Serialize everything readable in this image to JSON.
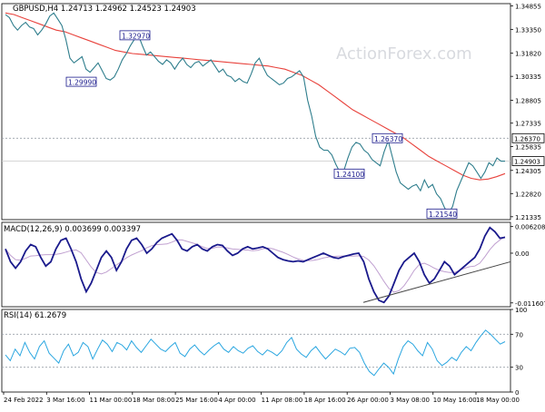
{
  "header": {
    "symbol_line": "GBPUSD,H4  1.24713 1.24962 1.24523 1.24903"
  },
  "watermark": "ActionForex.com",
  "colors": {
    "price": "#2e7d8c",
    "ma": "#e8423c",
    "macd": "#1a1a8c",
    "signal": "#c0a0d0",
    "rsi": "#2aa6e0",
    "axis": "#000000",
    "grid_dotted": "#9aa0a8",
    "label_border": "#1a1a8c"
  },
  "chart_data": [
    {
      "type": "line",
      "title": "GBPUSD,H4",
      "series": [
        {
          "name": "GBPUSD,H4",
          "values": [
            1.343,
            1.341,
            1.336,
            1.333,
            1.336,
            1.338,
            1.335,
            1.334,
            1.33,
            1.333,
            1.337,
            1.342,
            1.344,
            1.34,
            1.336,
            1.327,
            1.315,
            1.312,
            1.314,
            1.316,
            1.308,
            1.306,
            1.309,
            1.312,
            1.307,
            1.302,
            1.301,
            1.303,
            1.308,
            1.314,
            1.318,
            1.323,
            1.327,
            1.3297,
            1.323,
            1.317,
            1.319,
            1.316,
            1.313,
            1.311,
            1.314,
            1.312,
            1.308,
            1.312,
            1.315,
            1.311,
            1.309,
            1.312,
            1.313,
            1.31,
            1.312,
            1.314,
            1.31,
            1.306,
            1.308,
            1.304,
            1.303,
            1.3,
            1.302,
            1.3,
            1.299,
            1.305,
            1.312,
            1.315,
            1.309,
            1.304,
            1.302,
            1.3,
            1.298,
            1.299,
            1.302,
            1.303,
            1.305,
            1.307,
            1.303,
            1.288,
            1.278,
            1.265,
            1.258,
            1.256,
            1.256,
            1.253,
            1.247,
            1.242,
            1.243,
            1.251,
            1.258,
            1.261,
            1.26,
            1.256,
            1.254,
            1.25,
            1.248,
            1.246,
            1.255,
            1.262,
            1.252,
            1.242,
            1.235,
            1.233,
            1.231,
            1.233,
            1.234,
            1.23,
            1.237,
            1.232,
            1.234,
            1.228,
            1.225,
            1.219,
            1.2154,
            1.22,
            1.23,
            1.236,
            1.242,
            1.248,
            1.246,
            1.242,
            1.238,
            1.242,
            1.248,
            1.246,
            1.251,
            1.249,
            1.249
          ]
        },
        {
          "name": "MA",
          "values": [
            1.344,
            1.343,
            1.341,
            1.339,
            1.337,
            1.335,
            1.333,
            1.332,
            1.33,
            1.328,
            1.326,
            1.324,
            1.322,
            1.32,
            1.319,
            1.318,
            1.3175,
            1.317,
            1.3165,
            1.316,
            1.3155,
            1.315,
            1.3145,
            1.314,
            1.3135,
            1.313,
            1.3125,
            1.312,
            1.3115,
            1.311,
            1.3105,
            1.31,
            1.309,
            1.308,
            1.306,
            1.304,
            1.301,
            1.298,
            1.294,
            1.29,
            1.286,
            1.282,
            1.279,
            1.276,
            1.273,
            1.27,
            1.267,
            1.264,
            1.26,
            1.256,
            1.252,
            1.249,
            1.246,
            1.243,
            1.24,
            1.238,
            1.237,
            1.2375,
            1.239,
            1.241
          ]
        }
      ],
      "price_labels": [
        "1.32970",
        "1.29990",
        "1.26370",
        "1.24100",
        "1.21540"
      ],
      "y_ticks": [
        "1.34855",
        "1.33350",
        "1.31820",
        "1.30335",
        "1.28805",
        "1.27335",
        "1.25835",
        "1.24305",
        "1.22820",
        "1.21335"
      ],
      "marked_levels": [
        "1.26370",
        "1.24903"
      ],
      "ylim": [
        1.2115,
        1.35
      ]
    },
    {
      "type": "line",
      "title": "MACD(12,26,9) 0.003699 0.003397",
      "series": [
        {
          "name": "MACD",
          "values": [
            0.001,
            -0.002,
            -0.0035,
            -0.002,
            0.0005,
            0.002,
            0.0015,
            -0.001,
            -0.003,
            -0.002,
            0.001,
            0.003,
            0.0035,
            0.001,
            -0.002,
            -0.006,
            -0.009,
            -0.007,
            -0.004,
            -0.001,
            0.0005,
            -0.001,
            -0.004,
            -0.002,
            0.001,
            0.003,
            0.0035,
            0.002,
            0.0,
            0.001,
            0.0025,
            0.0035,
            0.004,
            0.0045,
            0.003,
            0.001,
            0.0005,
            0.0015,
            0.002,
            0.001,
            0.0005,
            0.0015,
            0.002,
            0.0018,
            0.0005,
            -0.0005,
            0.0,
            0.001,
            0.0015,
            0.001,
            0.0012,
            0.0015,
            0.001,
            0.0,
            -0.001,
            -0.0015,
            -0.0018,
            -0.002,
            -0.0018,
            -0.002,
            -0.0015,
            -0.001,
            -0.0005,
            0.0,
            -0.0005,
            -0.001,
            -0.0012,
            -0.0008,
            -0.0005,
            -0.0002,
            0.0,
            -0.002,
            -0.006,
            -0.009,
            -0.011,
            -0.0115,
            -0.01,
            -0.007,
            -0.004,
            -0.002,
            -0.001,
            0.0,
            -0.002,
            -0.005,
            -0.007,
            -0.006,
            -0.004,
            -0.002,
            -0.003,
            -0.005,
            -0.004,
            -0.003,
            -0.002,
            -0.001,
            0.001,
            0.004,
            0.006,
            0.005,
            0.0035,
            0.0037
          ]
        }
      ],
      "y_ticks": [
        "0.006208",
        "0.00",
        "-0.011607"
      ],
      "ylim": [
        -0.0125,
        0.0072
      ]
    },
    {
      "type": "line",
      "title": "RSI(14) 61.2679",
      "series": [
        {
          "name": "RSI",
          "values": [
            45,
            38,
            52,
            44,
            60,
            48,
            40,
            55,
            62,
            47,
            41,
            35,
            50,
            58,
            44,
            48,
            60,
            55,
            40,
            52,
            63,
            58,
            49,
            60,
            57,
            51,
            62,
            54,
            48,
            56,
            64,
            58,
            52,
            49,
            55,
            60,
            47,
            43,
            52,
            57,
            50,
            45,
            51,
            56,
            60,
            52,
            48,
            55,
            50,
            47,
            53,
            56,
            49,
            45,
            51,
            48,
            44,
            50,
            60,
            66,
            52,
            46,
            42,
            50,
            55,
            47,
            40,
            46,
            52,
            49,
            45,
            53,
            54,
            48,
            35,
            25,
            20,
            28,
            35,
            30,
            22,
            40,
            55,
            62,
            58,
            50,
            44,
            60,
            52,
            38,
            32,
            36,
            42,
            38,
            48,
            55,
            50,
            60,
            68,
            75,
            70,
            64,
            58,
            61
          ]
        }
      ],
      "y_ticks": [
        "100",
        "70",
        "30",
        "0"
      ],
      "ylim": [
        0,
        100
      ]
    }
  ],
  "x_axis": {
    "ticks": [
      "24 Feb 2022",
      "3 Mar 16:00",
      "11 Mar 00:00",
      "18 Mar 08:00",
      "25 Mar 16:00",
      "4 Apr 00:00",
      "11 Apr 08:00",
      "18 Apr 16:00",
      "26 Apr 00:00",
      "3 May 08:00",
      "10 May 16:00",
      "18 May 00:00"
    ]
  }
}
